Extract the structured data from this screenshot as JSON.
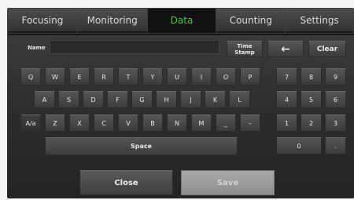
{
  "tabs": [
    {
      "label": "Focusing"
    },
    {
      "label": "Monitoring"
    },
    {
      "label": "Data",
      "active": true
    },
    {
      "label": "Counting"
    },
    {
      "label": "Settings"
    }
  ],
  "name_field": {
    "label": "Name",
    "value": ""
  },
  "buttons": {
    "time_stamp_line1": "Time",
    "time_stamp_line2": "Stamp",
    "backspace": "←",
    "clear": "Clear",
    "space": "Space",
    "close": "Close",
    "save": "Save",
    "case_toggle": "A/a"
  },
  "rows": {
    "row1": [
      "Q",
      "W",
      "E",
      "R",
      "T",
      "Y",
      "U",
      "I",
      "O",
      "P"
    ],
    "row2": [
      "A",
      "S",
      "D",
      "F",
      "G",
      "H",
      "J",
      "K",
      "L"
    ],
    "row3": [
      "Z",
      "X",
      "C",
      "V",
      "B",
      "N",
      "M",
      "_",
      "–"
    ]
  },
  "numpad": [
    "7",
    "8",
    "9",
    "4",
    "5",
    "6",
    "1",
    "2",
    "3"
  ],
  "numpad_zero": "0",
  "numpad_dot": ".",
  "colors": {
    "active_tab_text": "#3dd13d",
    "panel": "#2e2e2e"
  }
}
